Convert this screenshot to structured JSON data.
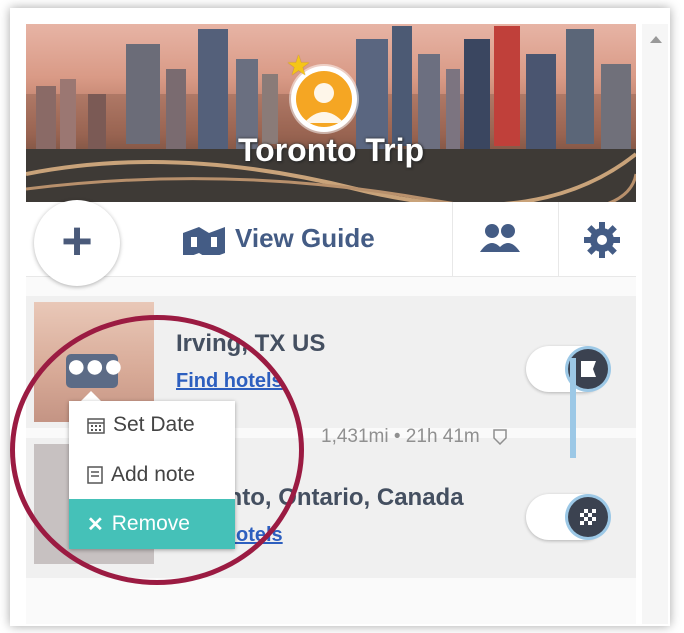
{
  "trip": {
    "title": "Toronto Trip"
  },
  "toolbar": {
    "view_guide_label": "View Guide"
  },
  "stops": [
    {
      "city": "Irving, TX US",
      "hotels_link": "Find hotels"
    },
    {
      "city": "Toronto, Ontario, Canada",
      "hotels_link": "Find hotels"
    }
  ],
  "route": {
    "distance": "1,431mi • 21h 41m"
  },
  "context_menu": {
    "set_date": "Set Date",
    "add_note": "Add note",
    "remove": "Remove"
  },
  "colors": {
    "accent": "#445c85",
    "link": "#2d5fbf",
    "remove_bg": "#45c1b8",
    "annotation": "#9b1b42",
    "route_line": "#9cc8e6"
  },
  "icons": [
    "plus-icon",
    "guide-map-icon",
    "people-icon",
    "gear-icon",
    "more-dots-icon",
    "calendar-icon",
    "note-icon",
    "close-icon",
    "start-flag-icon",
    "finish-flag-icon",
    "highway-shield-icon",
    "star-icon",
    "avatar-user-icon"
  ]
}
